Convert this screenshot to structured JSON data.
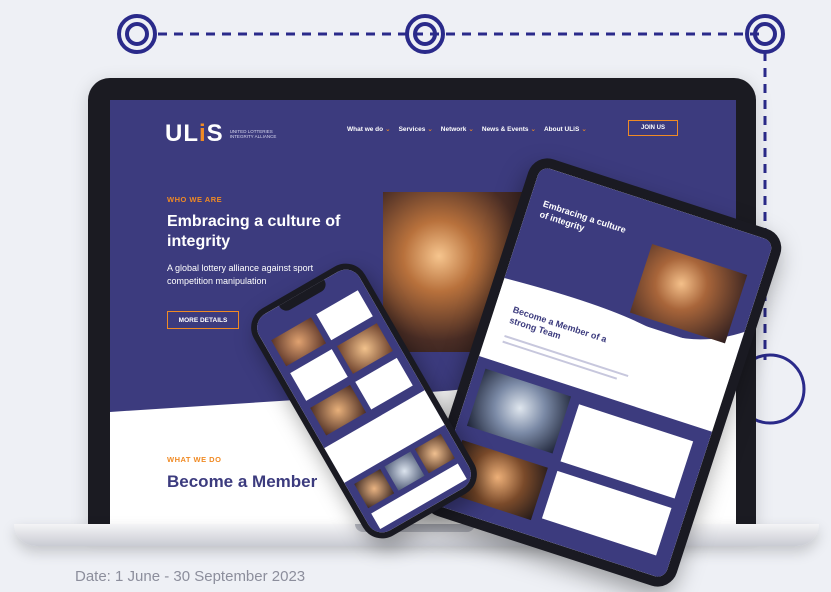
{
  "logo": {
    "brand_prefix": "UL",
    "brand_accent": "i",
    "brand_suffix": "S",
    "subtitle": "United Lotteries Integrity Alliance"
  },
  "nav": {
    "items": [
      {
        "label": "What we do",
        "chevron": "⌄"
      },
      {
        "label": "Services",
        "chevron": "⌄"
      },
      {
        "label": "Network",
        "chevron": "⌄"
      },
      {
        "label": "News & Events",
        "chevron": "⌄"
      },
      {
        "label": "About ULiS",
        "chevron": "⌄"
      }
    ],
    "join_label": "JOIN US"
  },
  "hero": {
    "eyebrow": "WHO WE ARE",
    "title": "Embracing a culture of integrity",
    "subtitle": "A global lottery alliance against sport competition manipulation",
    "button_label": "MORE DETAILS"
  },
  "section": {
    "eyebrow": "WHAT WE DO",
    "title": "Become a Member"
  },
  "tablet": {
    "hero_title": "Embracing a culture of integrity",
    "section_title": "Become a Member of a strong Team"
  },
  "footnote": "Date: 1 June - 30 September 2023",
  "colors": {
    "navy": "#3c3b7e",
    "orange": "#f08a24",
    "decor": "#2a2a8a"
  },
  "icons": [
    "circle-node-icon",
    "circle-node-icon",
    "circle-node-icon",
    "circle-outline-icon"
  ]
}
